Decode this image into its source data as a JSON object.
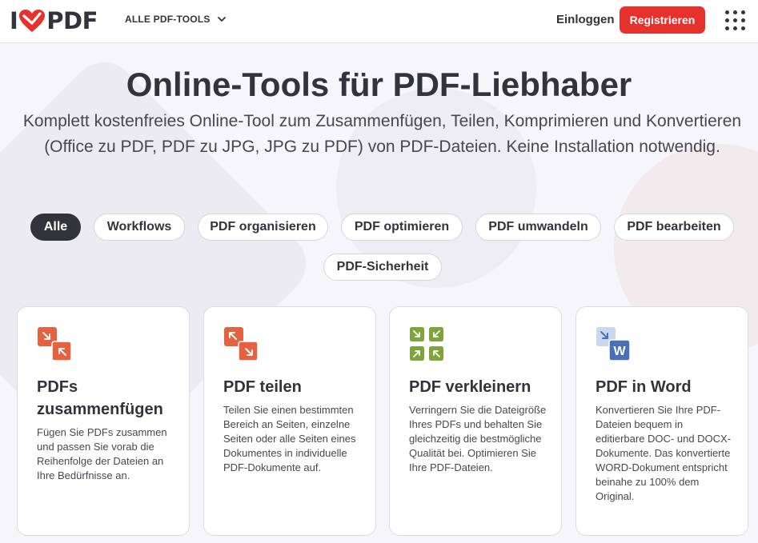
{
  "header": {
    "logo_left": "I",
    "logo_right": "PDF",
    "nav_tools_label": "ALLE PDF-TOOLS",
    "login_label": "Einloggen",
    "register_label": "Registrieren"
  },
  "hero": {
    "title": "Online-Tools für PDF-Liebhaber",
    "subtitle": "Komplett kostenfreies Online-Tool zum Zusammenfügen, Teilen, Komprimieren und Konvertieren (Office zu PDF, PDF zu JPG, JPG zu PDF) von PDF-Dateien. Keine Installation notwendig."
  },
  "filters": [
    {
      "label": "Alle",
      "active": true
    },
    {
      "label": "Workflows"
    },
    {
      "label": "PDF organisieren"
    },
    {
      "label": "PDF optimieren"
    },
    {
      "label": "PDF umwandeln"
    },
    {
      "label": "PDF bearbeiten"
    },
    {
      "label": "PDF-Sicherheit"
    }
  ],
  "tools": [
    {
      "title": "PDFs zusammenfügen",
      "description": "Fügen Sie PDFs zusammen und passen Sie vorab die Reihenfolge der Dateien an Ihre Bedürfnisse an.",
      "icon": "merge-icon"
    },
    {
      "title": "PDF teilen",
      "description": "Teilen Sie einen bestimmten Bereich an Seiten, einzelne Seiten oder alle Seiten eines Dokumentes in individuelle PDF-Dokumente auf.",
      "icon": "split-icon"
    },
    {
      "title": "PDF verkleinern",
      "description": "Verringern Sie die Dateigröße Ihres PDFs und behalten Sie gleichzeitig die bestmögliche Qualität bei. Optimieren Sie Ihre PDF-Dateien.",
      "icon": "compress-icon"
    },
    {
      "title": "PDF in Word",
      "description": "Konvertieren Sie Ihre PDF-Dateien bequem in editierbare DOC- und DOCX-Dokumente. Das konvertierte WORD-Dokument entspricht beinahe zu 100% dem Original.",
      "icon": "word-icon",
      "icon_letter": "W"
    }
  ],
  "colors": {
    "brand_red": "#e5322d",
    "tool_orange": "#e5613f",
    "compress_green": "#7ea53c",
    "word_blue": "#4a6fb5"
  }
}
